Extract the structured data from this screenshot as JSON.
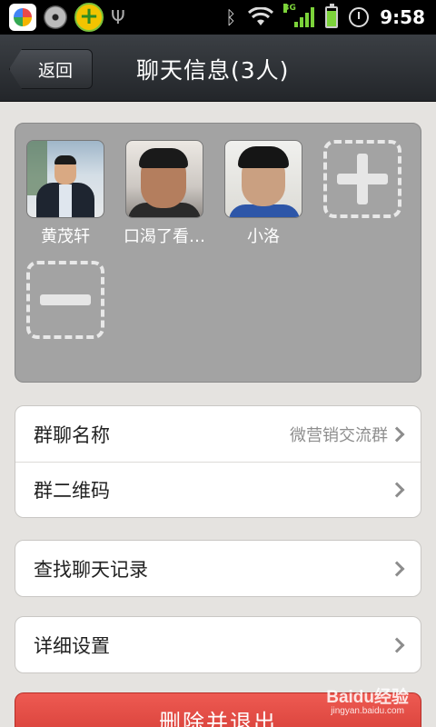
{
  "status_bar": {
    "time": "9:58",
    "network_type": "3G",
    "icons": [
      "app-store-icon",
      "media-disc-icon",
      "plus-shield-icon",
      "usb-icon",
      "bluetooth-icon",
      "wifi-icon",
      "signal-icon",
      "battery-icon",
      "alarm-icon"
    ],
    "accent_color": "#7cd33a"
  },
  "header": {
    "back_label": "返回",
    "title": "聊天信息(3人)"
  },
  "members": [
    {
      "name": "黄茂轩",
      "avatar": "avatar-photo-suit"
    },
    {
      "name": "口渴了看…",
      "avatar": "avatar-photo-indoor"
    },
    {
      "name": "小洛",
      "avatar": "avatar-photo-portrait"
    }
  ],
  "member_controls": {
    "add_icon": "plus-icon",
    "remove_icon": "minus-icon"
  },
  "group_info": {
    "name_label": "群聊名称",
    "name_value": "微营销交流群",
    "qr_label": "群二维码"
  },
  "search": {
    "label": "查找聊天记录"
  },
  "settings": {
    "label": "详细设置"
  },
  "delete_button": {
    "label": "删除并退出",
    "color": "#e04a43"
  },
  "watermark": {
    "logo": "Baidu经验",
    "url": "jingyan.baidu.com"
  }
}
